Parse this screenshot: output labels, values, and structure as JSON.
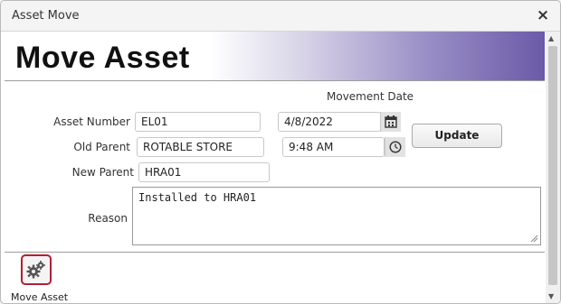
{
  "window": {
    "title": "Asset Move",
    "close_icon": "×"
  },
  "header": {
    "page_title": "Move Asset"
  },
  "form": {
    "movement_date_label": "Movement Date",
    "asset_number": {
      "label": "Asset Number",
      "value": "EL01"
    },
    "old_parent": {
      "label": "Old Parent",
      "value": "ROTABLE STORE"
    },
    "new_parent": {
      "label": "New Parent",
      "value": "HRA01"
    },
    "date": {
      "value": "4/8/2022"
    },
    "time": {
      "value": "9:48 AM"
    },
    "reason": {
      "label": "Reason",
      "value": "Installed to HRA01"
    },
    "update_label": "Update"
  },
  "actions": {
    "move_asset_label": "Move Asset",
    "icon": "gears-icon"
  },
  "colors": {
    "accent": "#6a5aa8",
    "action_border": "#b02035"
  }
}
